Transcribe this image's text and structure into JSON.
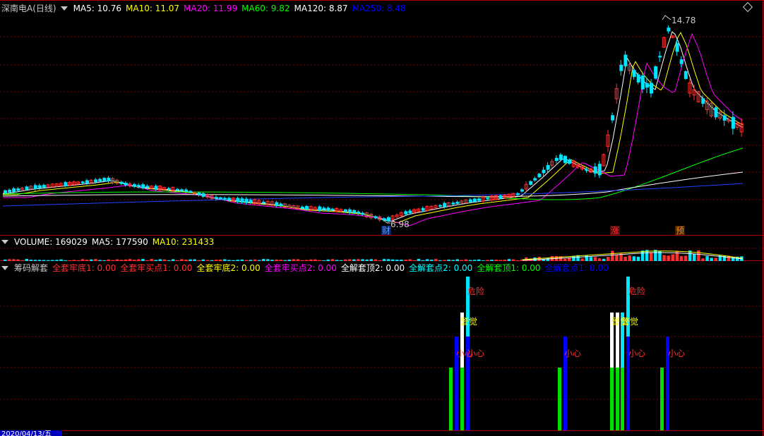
{
  "main_header": {
    "title": "深南电A(日线)",
    "items": [
      {
        "text": "MA5: 10.76",
        "color": "#ffffff"
      },
      {
        "text": "MA10: 11.07",
        "color": "#ffff00"
      },
      {
        "text": "MA20: 11.99",
        "color": "#ff00ff"
      },
      {
        "text": "MA60: 9.82",
        "color": "#00ff00"
      },
      {
        "text": "MA120: 8.87",
        "color": "#ffffff"
      },
      {
        "text": "MA250: 8.48",
        "color": "#0000ff"
      }
    ]
  },
  "price_annotations": {
    "high": "14.78",
    "low": "6.98"
  },
  "event_markers": [
    {
      "label": "财",
      "color": "#4aa0ff"
    },
    {
      "label": "涨",
      "color": "#ff3030"
    },
    {
      "label": "预",
      "color": "#ff8800"
    }
  ],
  "volume_header": {
    "items": [
      {
        "text": "VOLUME: 169029",
        "color": "#ffffff"
      },
      {
        "text": "MA5: 177590",
        "color": "#ffffff"
      },
      {
        "text": "MA10: 231433",
        "color": "#ffff00"
      }
    ]
  },
  "indicator_header": {
    "title": "筹码解套",
    "items": [
      {
        "text": "全套牢底1: 0.00",
        "color": "#ff3030"
      },
      {
        "text": "全套牢买点1: 0.00",
        "color": "#ff3030"
      },
      {
        "text": "全套牢底2: 0.00",
        "color": "#ffff00"
      },
      {
        "text": "全套牢买点2: 0.00",
        "color": "#ff00ff"
      },
      {
        "text": "全解套顶2: 0.00",
        "color": "#ffffff"
      },
      {
        "text": "全解套点2: 0.00",
        "color": "#00ffff"
      },
      {
        "text": "全解套顶1: 0.00",
        "color": "#00ff00"
      },
      {
        "text": "全解套点1: 0.00",
        "color": "#0000ff"
      }
    ]
  },
  "signal_labels": [
    {
      "text": "危险",
      "color": "#ff3030"
    },
    {
      "text": "警觉",
      "color": "#ffff00"
    },
    {
      "text": "小心",
      "color": "#ff3030"
    }
  ],
  "x_axis_date": "2020/04/13/五",
  "colors": {
    "up": "#ff3030",
    "down": "#00e5ff",
    "grid": "#7a0000",
    "frame": "#b00000"
  }
}
